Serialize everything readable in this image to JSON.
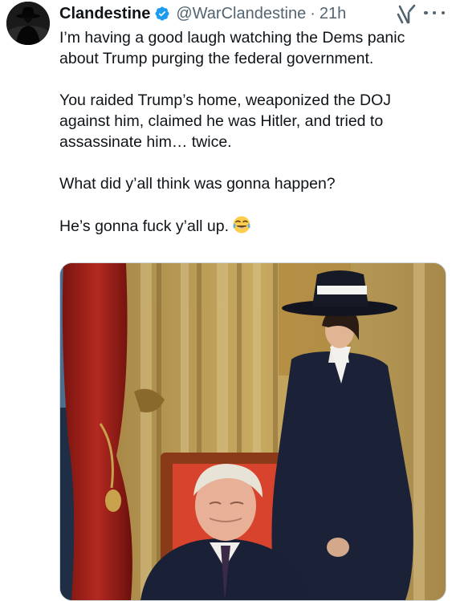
{
  "user": {
    "display_name": "Clandestine",
    "handle": "@WarClandestine",
    "separator": "·",
    "time": "21h",
    "verified_color": "#1d9bf0",
    "avatar_icon": "hat-silhouette-avatar"
  },
  "actions": {
    "grok_icon": "grok-icon",
    "more_icon": "more-dots-icon"
  },
  "tweet": {
    "paragraphs": [
      "I’m having a good laugh watching the Dems panic about Trump purging the federal government.",
      "You raided Trump’s home, weaponized the DOJ against him, claimed he was Hitler, and tried to assassinate him… twice.",
      "What did y’all think was gonna happen?",
      "He’s gonna fuck y’all up."
    ],
    "emoji": "face-with-tears-of-joy"
  },
  "media": {
    "type": "photo",
    "icon": "attached-photo"
  }
}
